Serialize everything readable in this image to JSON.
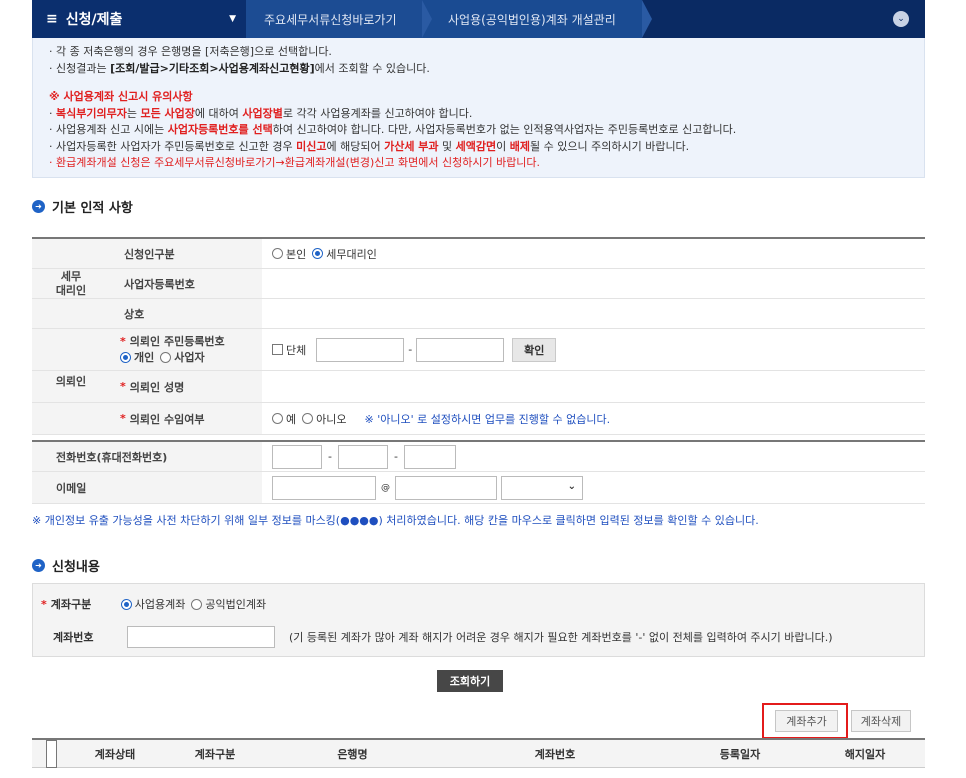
{
  "topbar": {
    "menu_label": "신청/제출",
    "crumbs": [
      "주요세무서류신청바로가기",
      "사업용(공익법인용)계좌 개설관리"
    ]
  },
  "notice": {
    "lines_top": [
      "· 각 종 저축은행의 경우 은행명을 [저축은행]으로 선택합니다.",
      "· 신청결과는 "
    ],
    "line2_bold": "[조회/발급>기타조회>사업용계좌신고현황]",
    "line2_tail": "에서 조회할 수 있습니다.",
    "warn_title": "※ 사업용계좌 신고시 유의사항",
    "l1_a": "복식부기의무자",
    "l1_b": "는 ",
    "l1_c": "모든 사업장",
    "l1_d": "에 대하여 ",
    "l1_e": "사업장별",
    "l1_f": "로 각각 사업용계좌를 신고하여야 합니다.",
    "l2_a": "사업용계좌 신고 시에는 ",
    "l2_b": "사업자등록번호를 선택",
    "l2_c": "하여 신고하여야 합니다. 다만, 사업자등록번호가 없는 인적용역사업자는 주민등록번호로 신고합니다.",
    "l3_a": "사업자등록한 사업자가 주민등록번호로 신고한 경우 ",
    "l3_b": "미신고",
    "l3_c": "에 해당되어 ",
    "l3_d": "가산세 부과",
    "l3_e": " 및 ",
    "l3_f": "세액감면",
    "l3_g": "이 ",
    "l3_h": "배제",
    "l3_i": "될 수 있으니 주의하시기 바랍니다.",
    "l4": "· 환급계좌개설 신청은 주요세무서류신청바로가기→환급계좌개설(변경)신고 화면에서 신청하시기 바랍니다."
  },
  "basic": {
    "title": "기본 인적 사항",
    "agent_group": "세무\n대리인",
    "rows": {
      "applicant_type_label": "신청인구분",
      "opt_self": "본인",
      "opt_agent": "세무대리인",
      "bizno_label": "사업자등록번호",
      "trade_label": "상호",
      "client_rrn_label": "의뢰인 주민등록번호",
      "opt_individual": "개인",
      "opt_business": "사업자",
      "group_chk": "단체",
      "confirm_btn": "확인",
      "client_group": "의뢰인",
      "client_name_label": "의뢰인 성명",
      "consent_label": "의뢰인 수임여부",
      "opt_yes": "예",
      "opt_no": "아니오",
      "consent_note": "※ '아니오' 로 설정하시면 업무를 진행할 수 없습니다."
    }
  },
  "contact": {
    "phone_label": "전화번호(휴대전화번호)",
    "email_label": "이메일",
    "at": "@"
  },
  "mask_note": "※ 개인정보 유출 가능성을 사전 차단하기 위해 일부 정보를 마스킹(●●●●) 처리하였습니다. 해당 칸을 마우스로 클릭하면 입력된 정보를 확인할 수 있습니다.",
  "apply": {
    "title": "신청내용",
    "acc_type_label": "계좌구분",
    "opt_biz": "사업용계좌",
    "opt_public": "공익법인계좌",
    "acc_no_label": "계좌번호",
    "acc_no_note": "(기 등록된 계좌가 많아 계좌 해지가 어려운 경우 해지가 필요한 계좌번호를 '-' 없이 전체를 입력하여 주시기 바랍니다.)",
    "search_btn": "조회하기",
    "add_btn": "계좌추가",
    "del_btn": "계좌삭제"
  },
  "acc_table": {
    "headers": [
      "계좌상태",
      "계좌구분",
      "은행명",
      "계좌번호",
      "등록일자",
      "해지일자"
    ]
  },
  "colors": {
    "nav": "#0a2a63",
    "accent": "#1f63c6",
    "warn": "#e02020",
    "highlight": "#e31b1b"
  }
}
